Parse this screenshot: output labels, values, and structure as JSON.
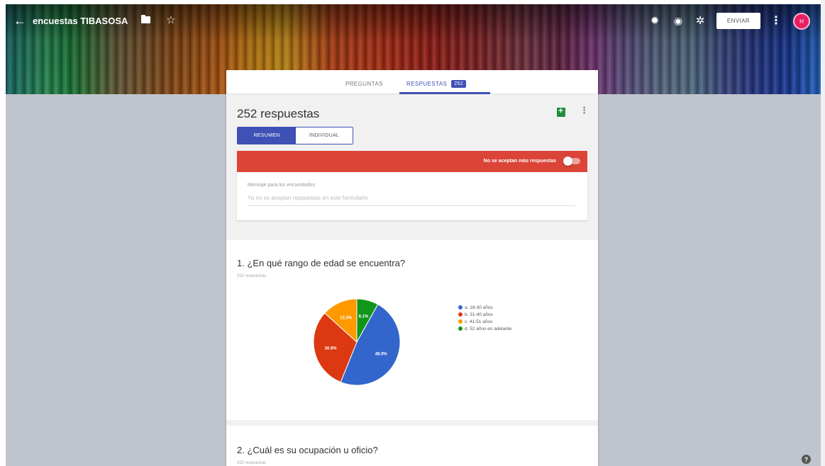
{
  "header": {
    "form_title": "encuestas TIBASOSA",
    "send_label": "ENVIAR",
    "avatar_initial": "H",
    "icons": [
      "back-arrow-icon",
      "folder-icon",
      "star-icon",
      "palette-icon",
      "eye-icon",
      "gear-icon",
      "more-vert-icon"
    ]
  },
  "tabs": {
    "questions_label": "PREGUNTAS",
    "responses_label": "RESPUESTAS",
    "responses_badge": "252"
  },
  "summary": {
    "count_title": "252 respuestas",
    "view_summary_label": "RESUMEN",
    "view_individual_label": "INDIVIDUAL",
    "accepting_label": "No se aceptan más respuestas",
    "message_label": "Mensaje para los encuestados",
    "message_placeholder": "Ya no se aceptan respuestas en este formulario"
  },
  "questions": [
    {
      "title": "1. ¿En qué rango de edad se encuentra?",
      "responses_label": "252 respuestas"
    },
    {
      "title": "2. ¿Cuál es su ocupación u oficio?",
      "responses_label": "252 respuestas"
    }
  ],
  "chart_data": {
    "type": "pie",
    "title": "1. ¿En qué rango de edad se encuentra?",
    "categories": [
      "a. 18-30 años",
      "b. 31-40 años",
      "c. 41-51 años",
      "d. 52 años en adelante"
    ],
    "values": [
      48.0,
      30.6,
      13.3,
      8.1
    ],
    "labels": [
      "48.0%",
      "30.6%",
      "13.3%",
      "8.1%"
    ],
    "colors": [
      "#3366cc",
      "#dc3912",
      "#ff9900",
      "#109618"
    ],
    "legend_position": "right"
  },
  "colors": {
    "accent": "#3f51b5",
    "accept_bar": "#db4437",
    "background": "#c0c4cc",
    "avatar": "#e91e63"
  }
}
